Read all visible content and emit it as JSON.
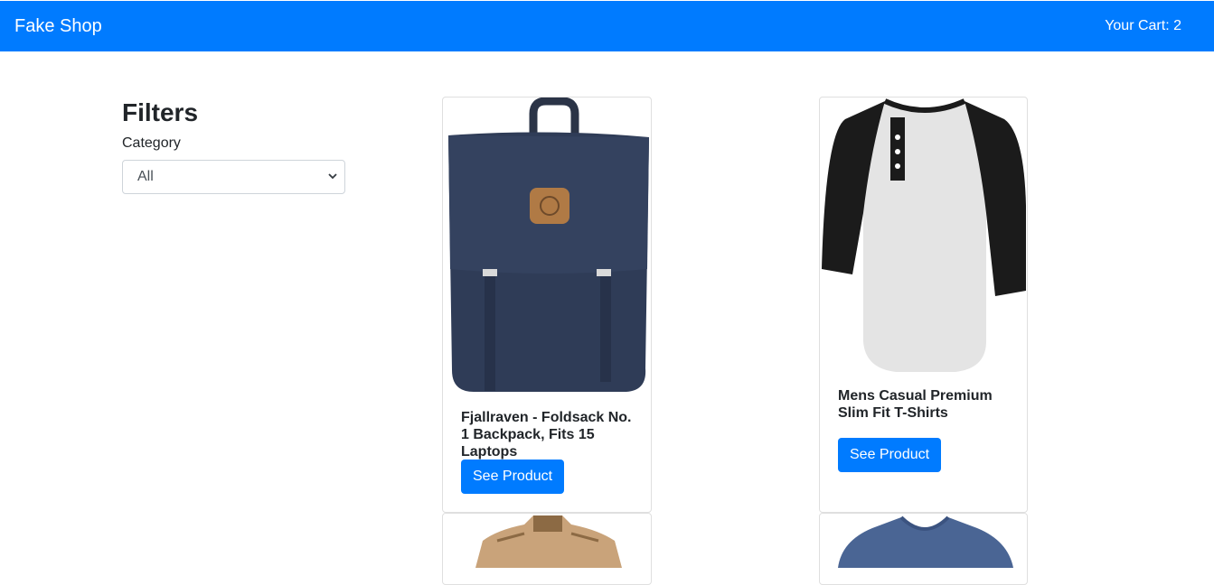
{
  "navbar": {
    "brand": "Fake Shop",
    "cart_label": "Your Cart: 2"
  },
  "filters": {
    "title": "Filters",
    "category_label": "Category",
    "category_selected": "All"
  },
  "products": [
    {
      "title": "Fjallraven - Foldsack No. 1 Backpack, Fits 15 Laptops",
      "button": "See Product",
      "image": "backpack-image"
    },
    {
      "title": "Mens Casual Premium Slim Fit T-Shirts",
      "button": "See Product",
      "image": "tshirt-image"
    },
    {
      "title": "",
      "button": "",
      "image": "jacket-image"
    },
    {
      "title": "",
      "button": "",
      "image": "blue-tshirt-image"
    }
  ],
  "colors": {
    "primary": "#007bff",
    "text": "#212529",
    "border": "#dfdfdf"
  }
}
